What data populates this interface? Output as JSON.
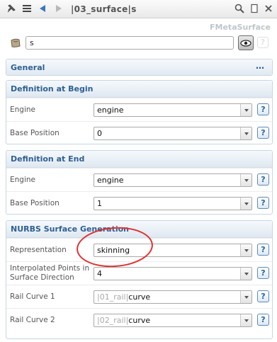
{
  "toolbar": {
    "title": "|03_surface|s"
  },
  "class_label": "FMetaSurface",
  "name": {
    "value": "s"
  },
  "sections": {
    "general": {
      "title": "General",
      "menu": "…"
    },
    "begin": {
      "title": "Definition at Begin",
      "engine_label": "Engine",
      "engine_value": "engine",
      "position_label": "Base Position",
      "position_value": "0"
    },
    "end": {
      "title": "Definition at End",
      "engine_label": "Engine",
      "engine_value": "engine",
      "position_label": "Base Position",
      "position_value": "1"
    },
    "nurbs": {
      "title": "NURBS Surface Generation",
      "representation_label": "Representation",
      "representation_value": "skinning",
      "interp_label": "Interpolated Points in Surface Direction",
      "interp_value": "4",
      "rail1_label": "Rail Curve 1",
      "rail1_prefix": "|01_rail|",
      "rail1_value": "curve",
      "rail2_label": "Rail Curve 2",
      "rail2_prefix": "|02_rail|",
      "rail2_value": "curve"
    }
  },
  "help_label": "?",
  "colors": {
    "accent": "#2f5f93",
    "annotation": "#e03030"
  }
}
